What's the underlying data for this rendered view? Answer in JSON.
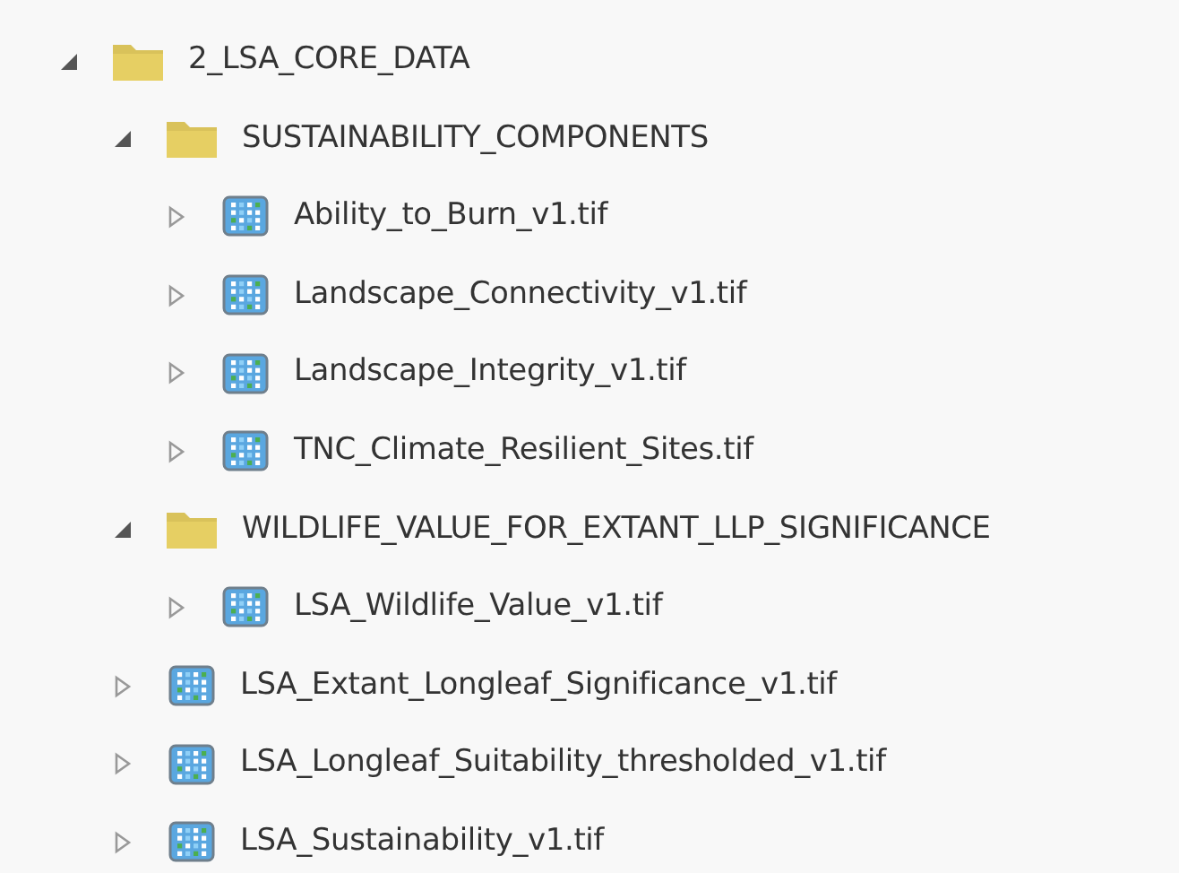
{
  "tree": [
    {
      "kind": "folder",
      "label": "2_LSA_CORE_DATA",
      "expanded": true,
      "children": [
        {
          "kind": "folder",
          "label": "SUSTAINABILITY_COMPONENTS",
          "expanded": true,
          "children": [
            {
              "kind": "raster",
              "label": "Ability_to_Burn_v1.tif",
              "expanded": false
            },
            {
              "kind": "raster",
              "label": "Landscape_Connectivity_v1.tif",
              "expanded": false
            },
            {
              "kind": "raster",
              "label": "Landscape_Integrity_v1.tif",
              "expanded": false
            },
            {
              "kind": "raster",
              "label": "TNC_Climate_Resilient_Sites.tif",
              "expanded": false
            }
          ]
        },
        {
          "kind": "folder",
          "label": "WILDLIFE_VALUE_FOR_EXTANT_LLP_SIGNIFICANCE",
          "expanded": true,
          "children": [
            {
              "kind": "raster",
              "label": "LSA_Wildlife_Value_v1.tif",
              "expanded": false
            }
          ]
        },
        {
          "kind": "raster",
          "label": "LSA_Extant_Longleaf_Significance_v1.tif",
          "expanded": false
        },
        {
          "kind": "raster",
          "label": "LSA_Longleaf_Suitability_thresholded_v1.tif",
          "expanded": false
        },
        {
          "kind": "raster",
          "label": "LSA_Sustainability_v1.tif",
          "expanded": false
        }
      ]
    }
  ]
}
